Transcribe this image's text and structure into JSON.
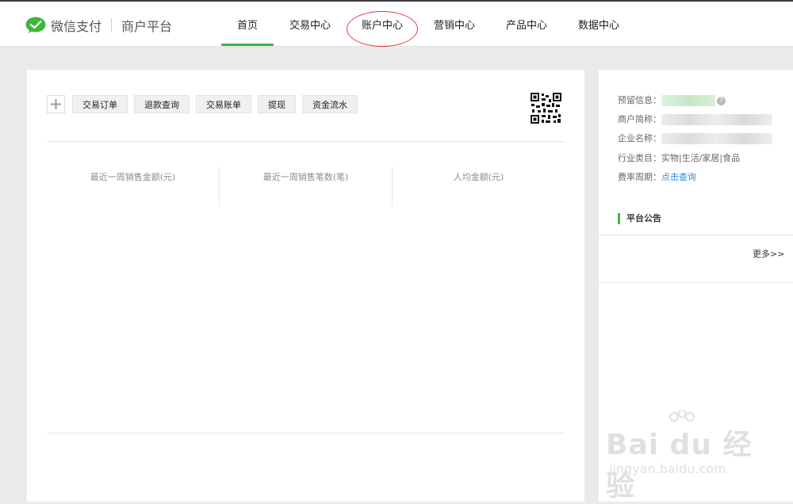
{
  "header": {
    "brand": "微信支付",
    "subtitle": "商户平台",
    "nav": [
      {
        "label": "首页",
        "active": true
      },
      {
        "label": "交易中心",
        "active": false
      },
      {
        "label": "账户中心",
        "active": false
      },
      {
        "label": "营销中心",
        "active": false
      },
      {
        "label": "产品中心",
        "active": false
      },
      {
        "label": "数据中心",
        "active": false
      }
    ]
  },
  "toolbar": {
    "buttons": [
      "交易订单",
      "退款查询",
      "交易账单",
      "提现",
      "资金流水"
    ]
  },
  "stats": [
    "最近一周销售金额(元)",
    "最近一周销售笔数(笔)",
    "人均金额(元)"
  ],
  "info": {
    "reserved_label": "预留信息：",
    "merchant_short_label": "商户简称：",
    "company_label": "企业名称：",
    "industry_label": "行业类目：",
    "industry_value": "实物|生活/家居|食品",
    "rate_label": "费率周期：",
    "rate_link": "点击查询"
  },
  "notice": {
    "title": "平台公告",
    "more": "更多>>"
  },
  "watermark": {
    "line1": "Bai du 经验",
    "line2": "jingyan.baidu.com"
  },
  "colors": {
    "accent": "#44b549",
    "link": "#2b8be8",
    "annotation": "#e23a3a"
  }
}
